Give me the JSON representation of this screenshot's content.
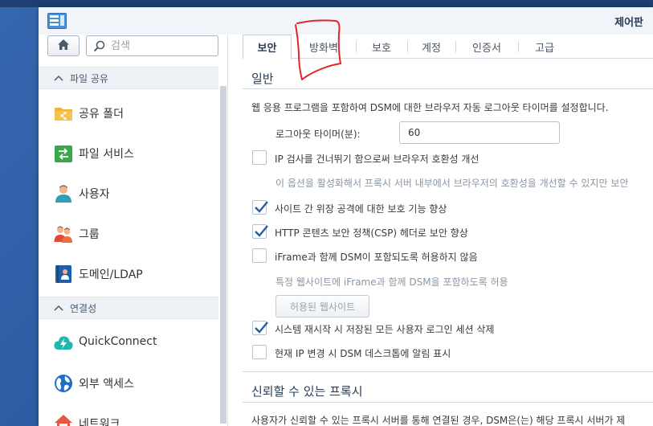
{
  "window": {
    "title": "제어판"
  },
  "sidebar": {
    "search_placeholder": "검색",
    "sections": [
      {
        "label": "파일 공유"
      },
      {
        "label": "연결성"
      }
    ],
    "items": [
      {
        "label": "공유 폴더",
        "icon": "shared-folder-icon"
      },
      {
        "label": "파일 서비스",
        "icon": "file-services-icon"
      },
      {
        "label": "사용자",
        "icon": "user-icon"
      },
      {
        "label": "그룹",
        "icon": "group-icon"
      },
      {
        "label": "도메인/LDAP",
        "icon": "domain-ldap-icon"
      },
      {
        "label": "QuickConnect",
        "icon": "quickconnect-icon"
      },
      {
        "label": "외부 액세스",
        "icon": "globe-icon"
      },
      {
        "label": "네트워크",
        "icon": "network-house-icon"
      }
    ]
  },
  "tabs": [
    {
      "label": "보안",
      "active": true
    },
    {
      "label": "방화벽",
      "active": false
    },
    {
      "label": "보호",
      "active": false
    },
    {
      "label": "계정",
      "active": false
    },
    {
      "label": "인증서",
      "active": false
    },
    {
      "label": "고급",
      "active": false
    }
  ],
  "general": {
    "title": "일반",
    "description": "웹 응용 프로그램을 포함하여 DSM에 대한 브라우저 자동 로그아웃 타이머를 설정합니다.",
    "logout_timer_label": "로그아웃 타이머(분):",
    "logout_timer_value": "60",
    "options": [
      {
        "label": "IP 검사를 건너뛰기 함으로써 브라우저 호환성 개선",
        "checked": false
      },
      {
        "label": "사이트 간 위장 공격에 대한 보호 기능 향상",
        "checked": true
      },
      {
        "label": "HTTP 콘텐츠 보안 정책(CSP) 헤더로 보안 향상",
        "checked": true
      },
      {
        "label": "iFrame과 함께 DSM이 포함되도록 허용하지 않음",
        "checked": false
      },
      {
        "label": "시스템 재시작 시 저장된 모든 사용자 로그인 세션 삭제",
        "checked": true
      },
      {
        "label": "현재 IP 변경 시 DSM 데스크톱에 알림 표시",
        "checked": false
      }
    ],
    "ip_check_note": "이 옵션을 활성화해서 프록시 서버 내부에서 브라우저의 호환성을 개선할 수 있지만 보안",
    "iframe_note": "특정 웹사이트에 iFrame과 함께 DSM을 포함하도록 허용",
    "allowed_sites_button": "허용된 웹사이트"
  },
  "trusted_proxy": {
    "title": "신뢰할 수 있는 프록시",
    "description": "사용자가 신뢰할 수 있는 프록시 서버를 통해 연결된 경우, DSM은(는) 해당 프록시 서버가 제"
  },
  "colors": {
    "accent": "#2a6dc2",
    "annotation": "#e0262b",
    "titlebar": "#f1f4f8"
  }
}
